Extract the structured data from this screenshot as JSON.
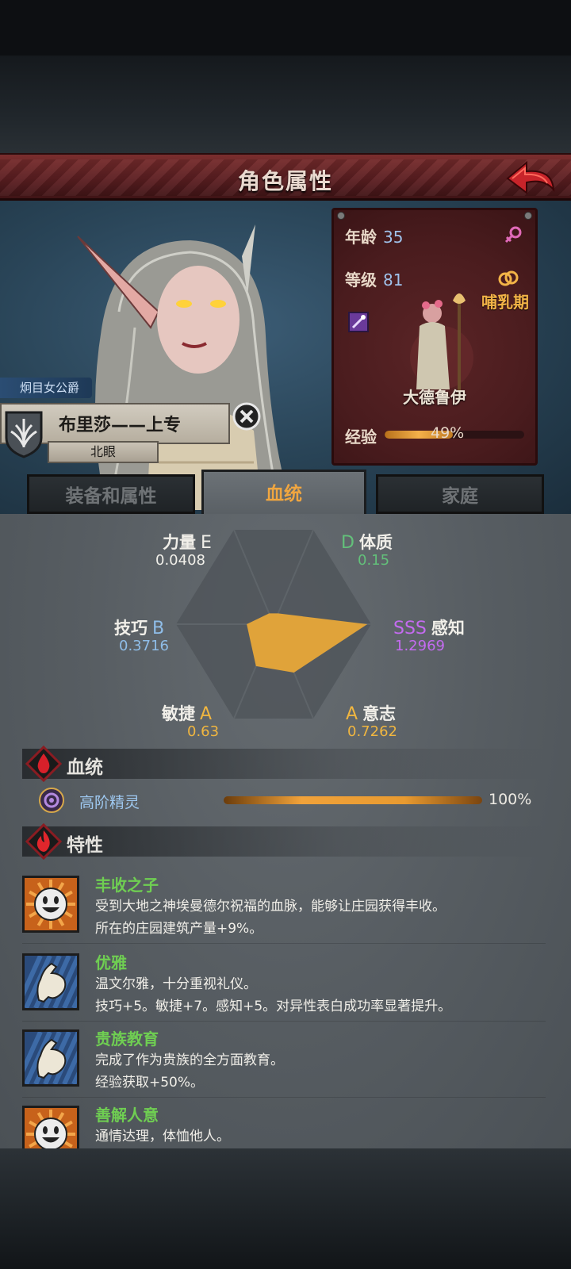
{
  "header": {
    "title": "角色属性"
  },
  "character": {
    "title_tag": "炯目女公爵",
    "name": "布里莎——上专",
    "sub": "北眼"
  },
  "info": {
    "age_label": "年龄",
    "age": "35",
    "level_label": "等级",
    "level": "81",
    "status": "哺乳期",
    "class_name": "大德鲁伊",
    "exp_label": "经验",
    "exp_percent": "49%",
    "exp_fraction": 0.49
  },
  "tabs": [
    "装备和属性",
    "血统",
    "家庭"
  ],
  "active_tab": 1,
  "stats": {
    "strength": {
      "label": "力量",
      "grade": "E",
      "value": "0.0408"
    },
    "constitution": {
      "label": "体质",
      "grade": "D",
      "value": "0.15"
    },
    "perception": {
      "label": "感知",
      "grade": "SSS",
      "value": "1.2969"
    },
    "will": {
      "label": "意志",
      "grade": "A",
      "value": "0.7262"
    },
    "agility": {
      "label": "敏捷",
      "grade": "A",
      "value": "0.63"
    },
    "skill": {
      "label": "技巧",
      "grade": "B",
      "value": "0.3716"
    }
  },
  "colors": {
    "grade_E": "#f0efe9",
    "grade_D": "#63c07a",
    "grade_SSS": "#c46bf0",
    "grade_A": "#f0b640",
    "grade_B": "#8fbde8",
    "radar_fill": "#e0a33a"
  },
  "bloodline": {
    "section_label": "血统",
    "name": "高阶精灵",
    "percent": "100%"
  },
  "traits_section": {
    "label": "特性"
  },
  "traits": [
    {
      "name": "丰收之子",
      "icon": "smile-sun-icon",
      "line1": "受到大地之神埃曼德尔祝福的血脉，能够让庄园获得丰收。",
      "line2": "所在的庄园建筑产量+9%。"
    },
    {
      "name": "优雅",
      "icon": "flex-arm-icon",
      "line1": "温文尔雅，十分重视礼仪。",
      "line2": "技巧+5。敏捷+7。感知+5。对异性表白成功率显著提升。"
    },
    {
      "name": "贵族教育",
      "icon": "flex-arm-icon",
      "line1": "完成了作为贵族的全方面教育。",
      "line2": "经验获取+50%。"
    },
    {
      "name": "善解人意",
      "icon": "smile-sun-icon",
      "line1": "通情达理，体恤他人。",
      "line2": ""
    }
  ]
}
